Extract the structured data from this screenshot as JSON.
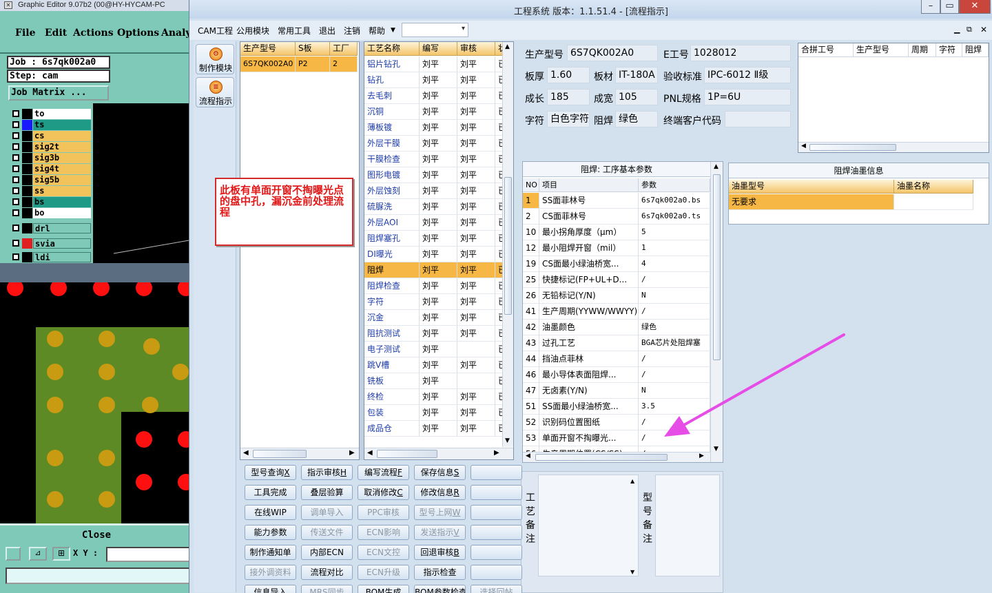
{
  "ge": {
    "title": "Graphic Editor 9.07b2 (00@HY-HYCAM-PC",
    "menu": [
      "File",
      "Edit",
      "Actions",
      "Options",
      "Analy"
    ],
    "job": "Job : 6s7qk002a0",
    "step": "Step: cam",
    "matrix_btn": "Job Matrix ...",
    "layers": [
      {
        "name": "to",
        "swatch": "#000000",
        "bg": "#ffffff"
      },
      {
        "name": "ts",
        "swatch": "#1a1aff",
        "bg": "#1f9a86"
      },
      {
        "name": "cs",
        "swatch": "#000000",
        "bg": "#f2c35a"
      },
      {
        "name": "sig2t",
        "swatch": "#000000",
        "bg": "#f2c35a"
      },
      {
        "name": "sig3b",
        "swatch": "#000000",
        "bg": "#f2c35a"
      },
      {
        "name": "sig4t",
        "swatch": "#000000",
        "bg": "#f2c35a"
      },
      {
        "name": "sig5b",
        "swatch": "#000000",
        "bg": "#f2c35a"
      },
      {
        "name": "ss",
        "swatch": "#000000",
        "bg": "#f2c35a"
      },
      {
        "name": "bs",
        "swatch": "#000000",
        "bg": "#1f9a86"
      },
      {
        "name": "bo",
        "swatch": "#000000",
        "bg": "#ffffff"
      }
    ],
    "extra_layers": [
      {
        "name": "drl",
        "swatch": "#000000",
        "bg": "#7fc9b9"
      },
      {
        "name": "svia",
        "swatch": "#e02020",
        "bg": "#7fc9b9"
      },
      {
        "name": "ldi",
        "swatch": "#000000",
        "bg": "#7fc9b9"
      }
    ],
    "close_label": "Close",
    "xy_label": "X Y :"
  },
  "app": {
    "title": "工程系统    版本：1.1.51.4 - [流程指示]",
    "menu": [
      "CAM工程",
      "公用模块",
      "常用工具",
      "退出",
      "注销",
      "帮助"
    ],
    "sidebar": [
      {
        "label": "制作模块",
        "icon": "gear-icon"
      },
      {
        "label": "流程指示",
        "icon": "flow-icon"
      }
    ]
  },
  "orders": {
    "columns": [
      "生产型号",
      "S板",
      "工厂"
    ],
    "rows": [
      [
        "6S7QK002A0",
        "P2",
        "2"
      ]
    ]
  },
  "process": {
    "columns": [
      "工艺名称",
      "编写",
      "审核",
      "状"
    ],
    "rows": [
      [
        "铝片钻孔",
        "刘平",
        "刘平",
        "已"
      ],
      [
        "钻孔",
        "刘平",
        "刘平",
        "已"
      ],
      [
        "去毛刺",
        "刘平",
        "刘平",
        "已"
      ],
      [
        "沉铜",
        "刘平",
        "刘平",
        "已"
      ],
      [
        "薄板镀",
        "刘平",
        "刘平",
        "已"
      ],
      [
        "外层干膜",
        "刘平",
        "刘平",
        "已"
      ],
      [
        "干膜检查",
        "刘平",
        "刘平",
        "已"
      ],
      [
        "图形电镀",
        "刘平",
        "刘平",
        "已"
      ],
      [
        "外层蚀刻",
        "刘平",
        "刘平",
        "已"
      ],
      [
        "硫脲洗",
        "刘平",
        "刘平",
        "已"
      ],
      [
        "外层AOI",
        "刘平",
        "刘平",
        "已"
      ],
      [
        "阻焊塞孔",
        "刘平",
        "刘平",
        "已"
      ],
      [
        "DI曝光",
        "刘平",
        "刘平",
        "已"
      ],
      [
        "阻焊",
        "刘平",
        "刘平",
        "已"
      ],
      [
        "阻焊检查",
        "刘平",
        "刘平",
        "已"
      ],
      [
        "字符",
        "刘平",
        "刘平",
        "已"
      ],
      [
        "沉金",
        "刘平",
        "刘平",
        "已"
      ],
      [
        "阻抗测试",
        "刘平",
        "刘平",
        "已"
      ],
      [
        "电子测试",
        "刘平",
        "",
        "已"
      ],
      [
        "跳V槽",
        "刘平",
        "刘平",
        "已"
      ],
      [
        "铣板",
        "刘平",
        "",
        "已"
      ],
      [
        "终检",
        "刘平",
        "刘平",
        "已"
      ],
      [
        "包装",
        "刘平",
        "刘平",
        "已"
      ],
      [
        "成品仓",
        "刘平",
        "刘平",
        "已"
      ]
    ],
    "selected_index": 13
  },
  "info": {
    "fields": [
      {
        "label": "生产型号",
        "value": "6S7QK002A0"
      },
      {
        "label": "E工号",
        "value": "1028012"
      },
      {
        "label": "板厚",
        "value": "1.60"
      },
      {
        "label": "板材",
        "value": "IT-180A"
      },
      {
        "label": "验收标准",
        "value": "IPC-6012 Ⅱ级"
      },
      {
        "label": "成长",
        "value": "185"
      },
      {
        "label": "成宽",
        "value": "105"
      },
      {
        "label": "PNL规格",
        "value": "1P=6U"
      },
      {
        "label": "字符",
        "value": "白色字符"
      },
      {
        "label": "阻焊",
        "value": "绿色"
      },
      {
        "label": "终端客户代码",
        "value": ""
      }
    ]
  },
  "merge": {
    "columns": [
      "合拼工号",
      "生产型号",
      "周期",
      "字符",
      "阻焊"
    ]
  },
  "params": {
    "title": "阻焊: 工序基本参数",
    "columns": [
      "NO",
      "项目",
      "参数"
    ],
    "rows": [
      [
        "1",
        "SS面菲林号",
        "6s7qk002a0.bs"
      ],
      [
        "2",
        "CS面菲林号",
        "6s7qk002a0.ts"
      ],
      [
        "10",
        "最小拐角厚度（μm）",
        "5"
      ],
      [
        "12",
        "最小阻焊开窗（mil）",
        "1"
      ],
      [
        "19",
        "CS面最小绿油桥宽...",
        "4"
      ],
      [
        "25",
        "快捷标记(FP+UL+D...",
        "/"
      ],
      [
        "26",
        "无铅标记(Y/N)",
        "N"
      ],
      [
        "41",
        "生产周期(YYWW/WWYY)",
        "/"
      ],
      [
        "42",
        "油墨颜色",
        "绿色"
      ],
      [
        "43",
        "过孔工艺",
        "BGA芯片处阻焊塞"
      ],
      [
        "44",
        "挡油点菲林",
        "/"
      ],
      [
        "46",
        "最小导体表面阻焊...",
        "/"
      ],
      [
        "47",
        "无卤素(Y/N)",
        "N"
      ],
      [
        "51",
        "SS面最小绿油桥宽...",
        "3.5"
      ],
      [
        "52",
        "识别码位置图纸",
        "/"
      ],
      [
        "53",
        "单面开窗不掏曝光...",
        "/"
      ],
      [
        "56",
        "生产周期位置(CS/SS)",
        "/"
      ]
    ]
  },
  "ink": {
    "title": "阻焊油墨信息",
    "columns": [
      "油墨型号",
      "油墨名称"
    ],
    "rows": [
      [
        "无要求",
        ""
      ]
    ]
  },
  "remarks": {
    "process_label": "工艺备注",
    "model_label": "型号备注"
  },
  "buttons": [
    {
      "label": "型号查询",
      "key": "X",
      "enabled": true
    },
    {
      "label": "指示审核",
      "key": "H",
      "enabled": true
    },
    {
      "label": "编写流程",
      "key": "F",
      "enabled": true
    },
    {
      "label": "保存信息",
      "key": "S",
      "enabled": true
    },
    {
      "label": "",
      "key": "",
      "enabled": true
    },
    {
      "label": "工具完成",
      "key": "",
      "enabled": true
    },
    {
      "label": "叠层验算",
      "key": "",
      "enabled": true
    },
    {
      "label": "取消修改",
      "key": "C",
      "enabled": true
    },
    {
      "label": "修改信息",
      "key": "R",
      "enabled": true
    },
    {
      "label": "",
      "key": "",
      "enabled": true
    },
    {
      "label": "在线WIP",
      "key": "",
      "enabled": true
    },
    {
      "label": "调单导入",
      "key": "",
      "enabled": false
    },
    {
      "label": "PPC审核",
      "key": "",
      "enabled": false
    },
    {
      "label": "型号上网",
      "key": "W",
      "enabled": false
    },
    {
      "label": "",
      "key": "",
      "enabled": true
    },
    {
      "label": "能力参数",
      "key": "",
      "enabled": true
    },
    {
      "label": "传送文件",
      "key": "",
      "enabled": false
    },
    {
      "label": "ECN影响",
      "key": "",
      "enabled": false
    },
    {
      "label": "发送指示",
      "key": "V",
      "enabled": false
    },
    {
      "label": "",
      "key": "",
      "enabled": true
    },
    {
      "label": "制作通知单",
      "key": "",
      "enabled": true
    },
    {
      "label": "内部ECN",
      "key": "",
      "enabled": true
    },
    {
      "label": "ECN文控",
      "key": "",
      "enabled": false
    },
    {
      "label": "回退审核",
      "key": "B",
      "enabled": true
    },
    {
      "label": "",
      "key": "",
      "enabled": true
    },
    {
      "label": "接外调资料",
      "key": "",
      "enabled": false
    },
    {
      "label": "流程对比",
      "key": "",
      "enabled": true
    },
    {
      "label": "ECN升级",
      "key": "",
      "enabled": false
    },
    {
      "label": "指示检查",
      "key": "",
      "enabled": true
    },
    {
      "label": "",
      "key": "",
      "enabled": true
    },
    {
      "label": "信息导入",
      "key": "",
      "enabled": true
    },
    {
      "label": "MRS同步",
      "key": "",
      "enabled": false
    },
    {
      "label": "BOM生成",
      "key": "",
      "enabled": true
    },
    {
      "label": "BOM参数检查",
      "key": "",
      "enabled": true
    },
    {
      "label": "选择回帖",
      "key": "",
      "enabled": false
    }
  ],
  "note": "此板有单面开窗不掏曝光点的盘中孔，漏沉金前处理流程",
  "colors": {
    "accent_orange": "#f4c56a",
    "annotation_red": "#e21717",
    "arrow_magenta": "#e64ce6"
  }
}
